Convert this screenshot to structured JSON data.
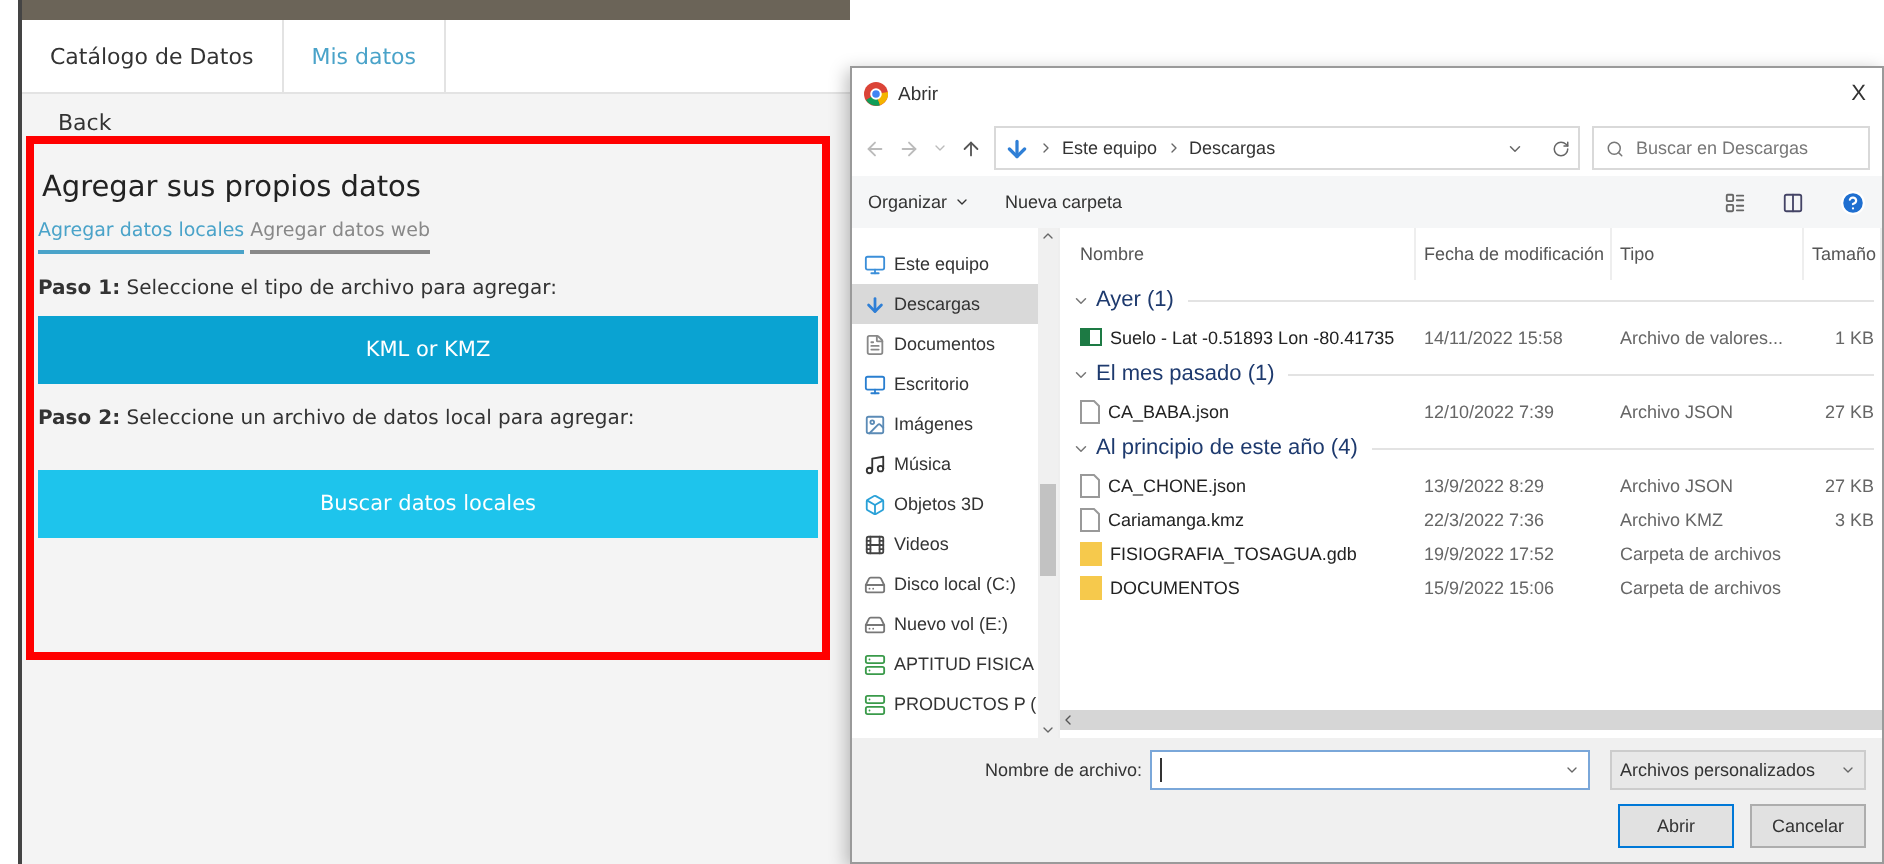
{
  "app": {
    "tabs": [
      {
        "label": "Catálogo de Datos",
        "selected": false
      },
      {
        "label": "Mis datos",
        "selected": true
      }
    ],
    "back": "Back",
    "panel": {
      "highlighted": true,
      "title": "Agregar sus propios datos",
      "subtabs": [
        {
          "label": "Agregar datos locales",
          "selected": true
        },
        {
          "label": "Agregar datos web",
          "selected": false
        }
      ],
      "steps": [
        {
          "label": "Paso 1:",
          "text": "Seleccione el tipo de archivo para agregar:",
          "button": "KML or KMZ",
          "kind": "select"
        },
        {
          "label": "Paso 2:",
          "text": "Seleccione un archivo de datos local para agregar:",
          "button": "Buscar datos locales",
          "kind": "browse"
        }
      ]
    }
  },
  "dialog": {
    "title": "Abrir",
    "close": "X",
    "path": [
      "Este equipo",
      "Descargas"
    ],
    "search": {
      "placeholder": "Buscar en Descargas"
    },
    "toolbar": [
      "Organizar",
      "Nueva carpeta"
    ],
    "sidebar": [
      {
        "label": "Este equipo",
        "selected": false
      },
      {
        "label": "Descargas",
        "selected": true
      },
      {
        "label": "Documentos",
        "selected": false
      },
      {
        "label": "Escritorio",
        "selected": false
      },
      {
        "label": "Imágenes",
        "selected": false
      },
      {
        "label": "Música",
        "selected": false
      },
      {
        "label": "Objetos 3D",
        "selected": false
      },
      {
        "label": "Videos",
        "selected": false
      },
      {
        "label": "Disco local (C:)",
        "selected": false
      },
      {
        "label": "Nuevo vol (E:)",
        "selected": false
      },
      {
        "label": "APTITUD FISICA",
        "selected": false
      },
      {
        "label": "PRODUCTOS P (",
        "selected": false
      }
    ],
    "columns": [
      "Nombre",
      "Fecha de modificación",
      "Tipo",
      "Tamaño"
    ],
    "groups": [
      {
        "label": "Ayer (1)",
        "expanded": true,
        "files": [
          {
            "name": "Suelo - Lat -0.51893 Lon -80.41735",
            "date": "14/11/2022 15:58",
            "type": "Archivo de valores...",
            "size": "1 KB",
            "kind": "sheet"
          }
        ]
      },
      {
        "label": "El mes pasado (1)",
        "expanded": true,
        "files": [
          {
            "name": "CA_BABA.json",
            "date": "12/10/2022 7:39",
            "type": "Archivo JSON",
            "size": "27 KB",
            "kind": "file"
          }
        ]
      },
      {
        "label": "Al principio de este año (4)",
        "expanded": true,
        "files": [
          {
            "name": "CA_CHONE.json",
            "date": "13/9/2022 8:29",
            "type": "Archivo JSON",
            "size": "27 KB",
            "kind": "file"
          },
          {
            "name": "Cariamanga.kmz",
            "date": "22/3/2022 7:36",
            "type": "Archivo KMZ",
            "size": "3 KB",
            "kind": "file"
          },
          {
            "name": "FISIOGRAFIA_TOSAGUA.gdb",
            "date": "19/9/2022 17:52",
            "type": "Carpeta de archivos",
            "kind": "folder"
          },
          {
            "name": "DOCUMENTOS",
            "date": "15/9/2022 15:06",
            "type": "Carpeta de archivos",
            "kind": "folder"
          }
        ]
      }
    ],
    "filename_label": "Nombre de archivo:",
    "filetype": "Archivos personalizados",
    "buttons": [
      {
        "label": "Abrir",
        "kind": "primary"
      },
      {
        "label": "Cancelar",
        "kind": "secondary"
      }
    ]
  }
}
